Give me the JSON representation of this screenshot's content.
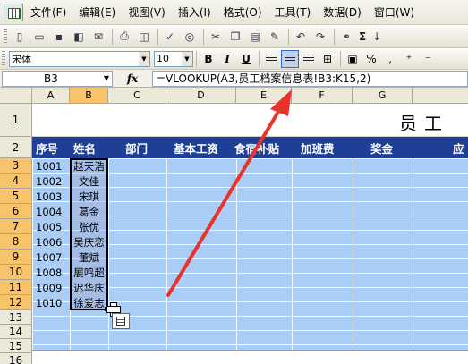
{
  "menu": {
    "items": [
      "文件(F)",
      "编辑(E)",
      "视图(V)",
      "插入(I)",
      "格式(O)",
      "工具(T)",
      "数据(D)",
      "窗口(W)"
    ]
  },
  "toolbar": {
    "sigma": "Σ"
  },
  "format_toolbar": {
    "font_name": "宋体",
    "font_size": "10",
    "bold": "B",
    "italic": "I",
    "underline": "U",
    "percent": "%"
  },
  "formula_bar": {
    "cell_ref": "B3",
    "fx": "fx",
    "formula": "=VLOOKUP(A3,员工档案信息表!B3:K15,2)"
  },
  "columns": [
    "A",
    "B",
    "C",
    "D",
    "E",
    "F",
    "G"
  ],
  "rows": [
    "1",
    "2",
    "3",
    "4",
    "5",
    "6",
    "7",
    "8",
    "9",
    "10",
    "11",
    "12",
    "13",
    "14",
    "15",
    "16"
  ],
  "sheet": {
    "title": "员工",
    "headers": [
      "序号",
      "姓名",
      "部门",
      "基本工资",
      "食宿补贴",
      "加班费",
      "奖金",
      "应"
    ],
    "records": [
      {
        "id": "1001",
        "name": "赵天浩"
      },
      {
        "id": "1002",
        "name": "文佳"
      },
      {
        "id": "1003",
        "name": "宋琪"
      },
      {
        "id": "1004",
        "name": "葛金"
      },
      {
        "id": "1005",
        "name": "张优"
      },
      {
        "id": "1006",
        "name": "吴庆恋"
      },
      {
        "id": "1007",
        "name": "董斌"
      },
      {
        "id": "1008",
        "name": "展鸣超"
      },
      {
        "id": "1009",
        "name": "迟华庆"
      },
      {
        "id": "1010",
        "name": "徐爱志"
      }
    ]
  },
  "colors": {
    "header_fill": "#1f3f96",
    "body_fill": "#a9cdf5",
    "selection_header": "#f7c46c",
    "annotation_arrow": "#e8322a"
  }
}
